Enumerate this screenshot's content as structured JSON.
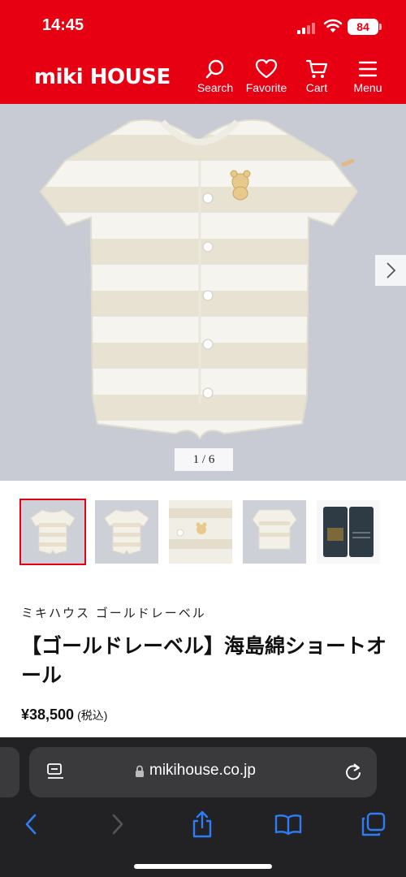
{
  "status": {
    "time": "14:45",
    "battery": "84"
  },
  "header": {
    "logo": "miki HOUSE",
    "nav": [
      {
        "label": "Search",
        "icon": "search-icon"
      },
      {
        "label": "Favorite",
        "icon": "heart-icon"
      },
      {
        "label": "Cart",
        "icon": "cart-icon"
      },
      {
        "label": "Menu",
        "icon": "menu-icon"
      }
    ]
  },
  "gallery": {
    "counter": "1 /   6",
    "current": 1,
    "total": 6
  },
  "product": {
    "brand": "ミキハウス ゴールドレーベル",
    "title": "【ゴールドレーベル】海島綿ショートオール",
    "price": "¥38,500",
    "tax": "(税込)"
  },
  "browser": {
    "url": "mikihouse.co.jp"
  },
  "colors": {
    "brand_red": "#e60012",
    "toolbar_blue": "#2f7df6"
  }
}
